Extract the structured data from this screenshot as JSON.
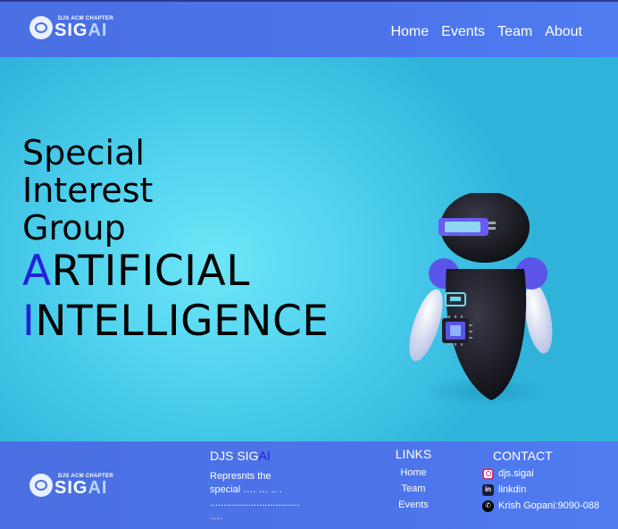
{
  "header": {
    "logo": {
      "chapter": "DJS ACM CHAPTER",
      "sig": "SIG",
      "ai": "AI"
    },
    "nav": [
      "Home",
      "Events",
      "Team",
      "About"
    ]
  },
  "hero": {
    "line1": "Special",
    "line2": "Interest",
    "line3": "Group",
    "artificial_first": "A",
    "artificial_rest": "RTIFICIAL",
    "intelligence_first": "I",
    "intelligence_rest": "NTELLIGENCE"
  },
  "footer": {
    "logo": {
      "chapter": "DJS ACM CHAPTER",
      "sig": "SIG",
      "ai": "AI"
    },
    "about": {
      "title_main": "DJS SIG",
      "title_ai": "AI",
      "desc_line1": "Represnts the",
      "desc_line2": "special …. … .. .",
      "desc_line3": ".................................",
      "desc_line4": "…."
    },
    "links": {
      "title": "LINKS",
      "items": [
        "Home",
        "Team",
        "Events"
      ]
    },
    "contact": {
      "title": "CONTACT",
      "instagram": "djs.sigai",
      "linkedin": "linkdin",
      "phone": "Krish Gopani:9090-088"
    }
  },
  "colors": {
    "header_bg": "#4a6fe3",
    "hero_bg": "#5ad3ee",
    "accent": "#2222d9"
  },
  "icons": [
    "brain-logo-icon",
    "instagram-icon",
    "linkedin-icon",
    "phone-icon"
  ]
}
